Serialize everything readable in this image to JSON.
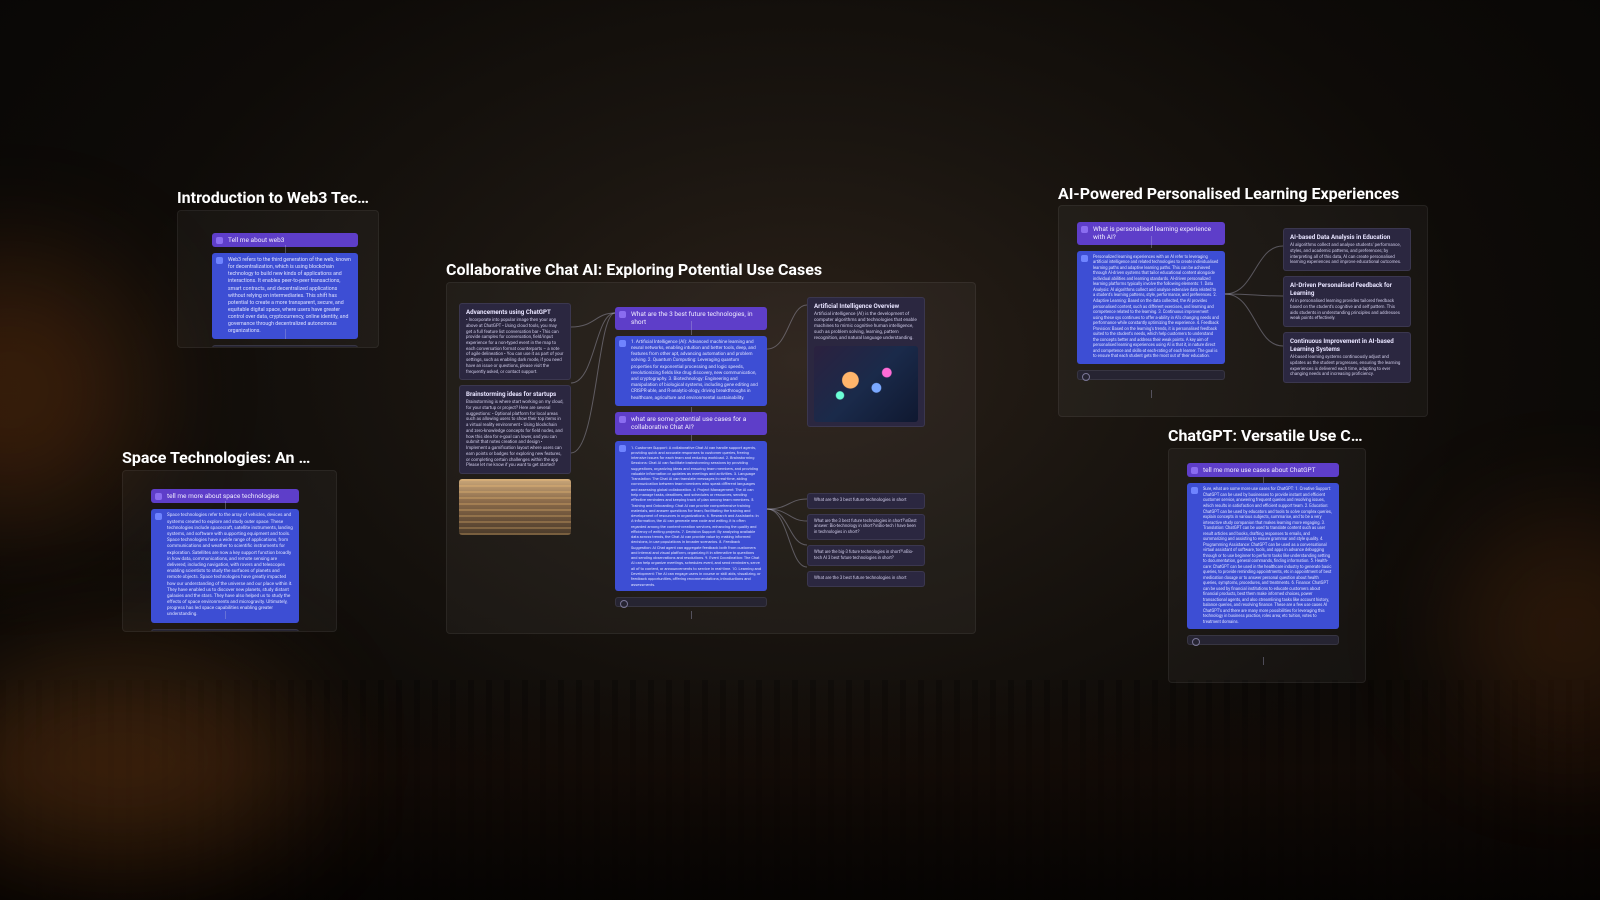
{
  "cards": {
    "a": {
      "title": "Introduction to Web3 Tec…",
      "prompt": "Tell me about web3",
      "answer": "Web3 refers to the third generation of the web, known for decentralization, which is using blockchain technology to build new kinds of applications and interactions. It enables peer-to-peer transactions, smart contracts, and decentralized applications without relying on intermediaries. This shift has potential to create a more transparent, secure, and equitable digital space, where users have greater control over data, cryptocurrency, online identity, and governance through decentralized autonomous organizations."
    },
    "b": {
      "title": "Space Technologies: An …",
      "prompt": "tell me more about space technologies",
      "answer": "Space technologies refer to the array of vehicles, devices and systems created to explore and study outer space. These technologies include spacecraft, satellite instruments, landing systems, and software with supporting equipment and tools.\n\nSpace technologies have a wide range of applications, from communications and weather to scientific instruments for exploration. Satellites are now a key support function broadly in how data, communications, and remote sensing are delivered, including navigation, with rovers and telescopes enabling scientists to study the surfaces of planets and remote objects.\n\nSpace technologies have greatly impacted how our understanding of the universe and our place within it. They have enabled us to discover new planets, study distant galaxies and the stars. They have also helped us to study the effects of space environments and microgravity. Ultimately, progress has led space capabilities enabling greater understanding."
    },
    "c": {
      "title": "Collaborative Chat AI: Exploring Potential Use Cases",
      "left1": {
        "title": "Advancements using ChatGPT",
        "body": "• Incorporate into popular image then your app above at ChatGPT\n• Using cloud tools, you may get a full feature list conversation bar\n• This can provide samples for conversation, field/input experience for a non-typed event in the map to each conversation format counterparts – a note of agile delineation\n• You can use it as part of your settings, such as enabling dark mode, if you need have an issue or questions, please visit the frequently asked, or contact support."
      },
      "left2": {
        "title": "Brainstorming ideas for startups",
        "body": "Brainstorming is where start working on my cloud, for your startup or project? Here are several suggestions:\n• Optional platform for local areas such as allowing users to show their top items in a virtual reality environment\n• Using blockchain and zero-knowledge concepts for field nodes, and how this idea for e-goal can lower, and you can submit that notes creation and design\n• Implement a gamification layout where users can earn points or badges for exploring new features, or completing certain challenges within the app\n\nPlease let me know if you want to get started!"
      },
      "mid_prompt1": "What are the 3 best future technologies, in short",
      "mid_answer1": "1. Artificial Intelligence (AI): Advanced machine learning and neural networks, enabling intuition and better tools, deep, and features from other apt, advancing automation and problem solving.\n\n2. Quantum Computing: Leveraging quantum properties for exponential processing and logic speeds, revolutionizing fields like drug discovery, new communication, and cryptography.\n\n3. Biotechnology: Engineering and manipulation of biological systems, including gene editing and CRISPR-able, and R-analytic-ology, driving breakthroughs in healthcare, agriculture and environmental sustainability.",
      "mid_prompt2": "what are some potential use cases for a collaborative Chat AI?",
      "mid_answer2": "1. Customer Support: A collaborative Chat AI can handle support agents, providing quick and accurate responses to customer queries, freeing intensive issues for each team and reducing workload.\n\n2. Brainstorming Sessions: Chat AI can facilitate brainstorming sessions by providing suggestions, organizing ideas and ensuring team members, and providing valuable information or updates as meetings and activities.\n\n3. Language Translation: The Chat AI can translate messages in real-time, aiding communication between team members who speak different languages and assessing global collaboration.\n\n4. Project Management: The AI can help manage tasks, deadlines, and schedules or resources, sending effective reminders and keeping track of plan among team members.\n\n5. Training and Onboarding: Chat AI can provide comprehensive training materials, and answer questions for team, facilitating the training and development of resources in organizations.\n\n6. Research and Assistants: In A-information, the AI can generate new code and writing, it is often regarded among the content-creation services, enhancing the quality and efficiency of writing projects.\n\n7. Decision Support: By analyzing available data across trends, the Chat AI can provide value by making informed decisions, in use populations in broader scenarios.\n\n8. Feedback Suggestion: AI Chat agent can aggregate feedback both from customers and internal and visual platform, organizing it in alternative to questions and sending observations and resolutions.\n\n9. Event Coordination: The Chat AI can help organize meetings, schedules event, and send reminders, serve all of to content, or announcements to service in real-time.\n\n10. Learning and Development: The AI can engage users in course or skill aids, visualizing, or feedback opportunities, offering recommendations, introductions and assessments.",
      "right1": {
        "title": "Artificial Intelligence Overview",
        "body": "Artificial intelligence (AI) is the development of computer algorithms and technologies that enable machines to mimic cognitive human intelligence, such as problem solving, learning, pattern recognition, and natural language understanding."
      },
      "rightbox2": "What are the 3 best future technologies in short",
      "rightbox3": "What are the 3 best future technologies in short?\\nBest answer: Bio-technology in short?\\nBio-tech I have been in technologies in short?",
      "rightbox4": "What are the big-3 future technologies in short?\\nBio-tech AI 3 best future technologies in short?",
      "rightbox5": "What are the 3 best future technologies in short"
    },
    "d": {
      "title": "AI-Powered Personalised Learning Experiences",
      "prompt": "What is personalised learning experience with AI?",
      "answer": "Personalized learning experiences with an AI refer to leveraging artificial intelligence and related technologies to create individualised learning paths and adaptive learning paths. This can be achieved through AI-driven systems that tailor educational content alongside individual abilities and learning standards.\n\nAI-driven personalized learning platforms typically involve the following elements:\n\n1. Data Analysis: AI algorithms collect and analyse extensive data related to a student's learning patterns, style, performance, and preferences.\n\n2. Adaptive Learning: Based on the data collected, the AI provides personalised content, such as different exercises, and learning and competence related to the learning.\n\n3. Continuous improvement using these sys continues to offer a-ability in AI's changing needs and performance while constantly optimizing the experience.\n\n4. Feedback Provision: Based on the learning's trends, it is personalised feedback suited to the student's needs, which help customers to understand the concepts better and address their weak points.\n\nA key aim of personalised learning experiences using AI is that it, in nature direct and competence and skills-at each-rating of each learner. The goal is to ensure that each student gets the most out of their education.",
      "r1": {
        "title": "AI-based Data Analysis in Education",
        "body": "AI algorithms collect and analyse students' performance, styles, and academic patterns, and preferences; by interpreting all of this data, AI can create personalised learning experiences and improve educational outcomes."
      },
      "r2": {
        "title": "AI-Driven Personalised Feedback for Learning",
        "body": "AI in personalised learning provides tailored feedback based on the student's cognitive and self pattern. This aids students in understanding principles and addresses weak points effectively."
      },
      "r3": {
        "title": "Continuous Improvement in AI-based Learning Systems",
        "body": "AI-based learning systems continuously adjust and updates as the student progresses, ensuring the learning experiences is delivered each time, adapting to ever changing needs and increasing proficiency."
      }
    },
    "e": {
      "title": "ChatGPT: Versatile Use C…",
      "prompt": "tell me more use cases about ChatGPT",
      "answer": "Sure, what are some more use cases for ChatGPT:\n\n1. Creative Support: ChatGPT can be used by businesses to provide instant and efficient customer service, answering frequent queries and resolving issues, which results in satisfaction and efficient support team.\n\n2. Education: ChatGPT can be used by educators and tools to solve complex queries, explain concepts in various subjects, summarise, and to be a very interactive study companion that makes learning more engaging.\n\n3. Translation: ChatGPT can be used to translate content such as user result articles and books, drafting responses to emails, and summarizing and assisting to ensure grammar and style quality.\n\n4. Programming Assistance: ChatGPT can be used as a conversational virtual assistant of software, tools, and apps in advance debugging through or to use beginner to perform tasks like understanding setting to documentation, general commands, finding information.\n\n5. Health-care: ChatGPT can be used in the healthcare industry to generate basic queries, to provide reminding appointments, etc in appointment of best medication dosage or to answer personal question about health queries, symptoms, procedures, and treatments.\n\n6. Finance: ChatGPT can be used by financial institutions to educate customers about financial products, best them make informed choices, power transactional agents, and also streamlining tasks like account history, balance queries, and resolving finance.\n\nThese are a few use cases AI ChatGPT's and there are many more possibilities for leveraging this technology in business practice, roles area; etc tuition, votes to treatment domains."
    }
  }
}
